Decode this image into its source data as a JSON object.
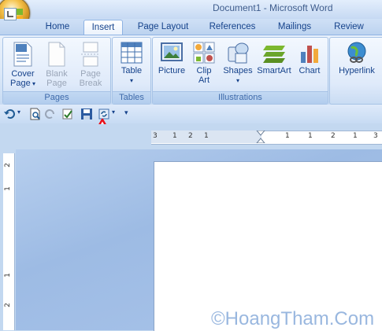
{
  "window": {
    "title": "Document1 - Microsoft Word"
  },
  "tabs": [
    {
      "label": "Home"
    },
    {
      "label": "Insert"
    },
    {
      "label": "Page Layout"
    },
    {
      "label": "References"
    },
    {
      "label": "Mailings"
    },
    {
      "label": "Review"
    }
  ],
  "active_tab": "Insert",
  "ribbon": {
    "pages": {
      "label": "Pages",
      "cover_page_l1": "Cover",
      "cover_page_l2": "Page",
      "blank_page_l1": "Blank",
      "blank_page_l2": "Page",
      "page_break_l1": "Page",
      "page_break_l2": "Break"
    },
    "tables": {
      "label": "Tables",
      "table": "Table"
    },
    "illustrations": {
      "label": "Illustrations",
      "picture": "Picture",
      "clip_art_l1": "Clip",
      "clip_art_l2": "Art",
      "shapes": "Shapes",
      "smartart": "SmartArt",
      "chart": "Chart"
    },
    "links": {
      "hyperlink": "Hyperlink"
    }
  },
  "ruler": {
    "h_numbers": [
      "3",
      "1",
      "2",
      "1",
      "1",
      "1",
      "2",
      "1",
      "3"
    ],
    "v_numbers": [
      "2",
      "1",
      "1",
      "2"
    ]
  },
  "watermark": "©HoangTham.Com",
  "colors": {
    "accent": "#15428b",
    "arrow": "#e8101a",
    "ribbon_bg": "#dbe8f8"
  }
}
